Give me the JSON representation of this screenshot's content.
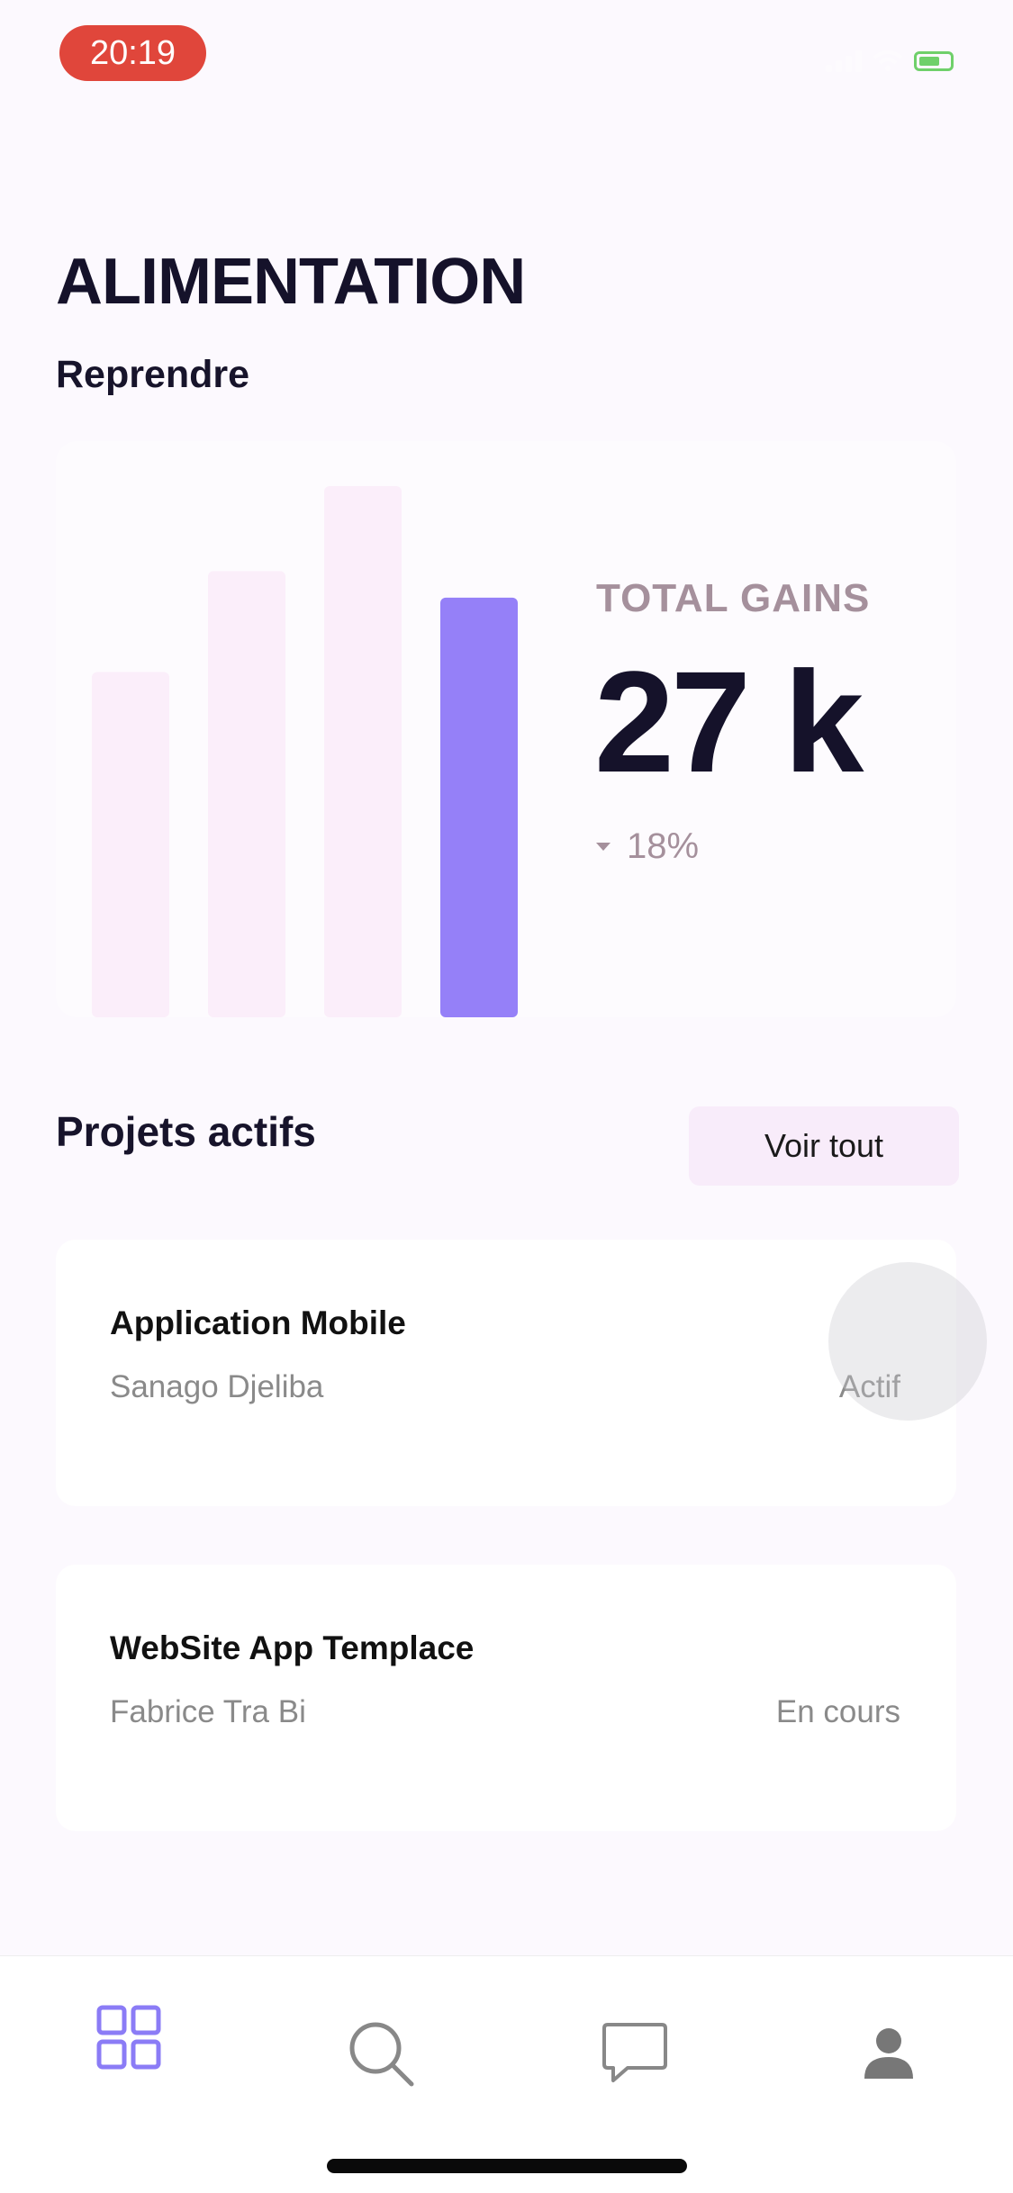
{
  "status_bar": {
    "time": "20:19"
  },
  "header": {
    "title": "ALIMENTATION",
    "subtitle": "Reprendre"
  },
  "summary": {
    "label": "TOTAL GAINS",
    "value": "27 k",
    "change": "18%",
    "change_direction": "down",
    "bars": [
      {
        "value": 0.65,
        "highlighted": false
      },
      {
        "value": 0.84,
        "highlighted": false
      },
      {
        "value": 1.0,
        "highlighted": false
      },
      {
        "value": 0.79,
        "highlighted": true
      }
    ],
    "colors": {
      "bar": "#fbeefa",
      "bar_highlight": "#9580f8"
    }
  },
  "projects": {
    "title": "Projets actifs",
    "see_all_label": "Voir tout",
    "items": [
      {
        "name": "Application Mobile",
        "owner": "Sanago Djeliba",
        "status": "Actif"
      },
      {
        "name": "WebSite App Templace",
        "owner": "Fabrice Tra Bi",
        "status": "En cours"
      }
    ]
  },
  "tab_bar": {
    "items": [
      {
        "icon": "grid-icon",
        "active": true
      },
      {
        "icon": "search-icon",
        "active": false
      },
      {
        "icon": "chat-icon",
        "active": false
      },
      {
        "icon": "profile-icon",
        "active": false
      }
    ],
    "colors": {
      "active": "#8b7cf6",
      "inactive": "#888888"
    }
  }
}
